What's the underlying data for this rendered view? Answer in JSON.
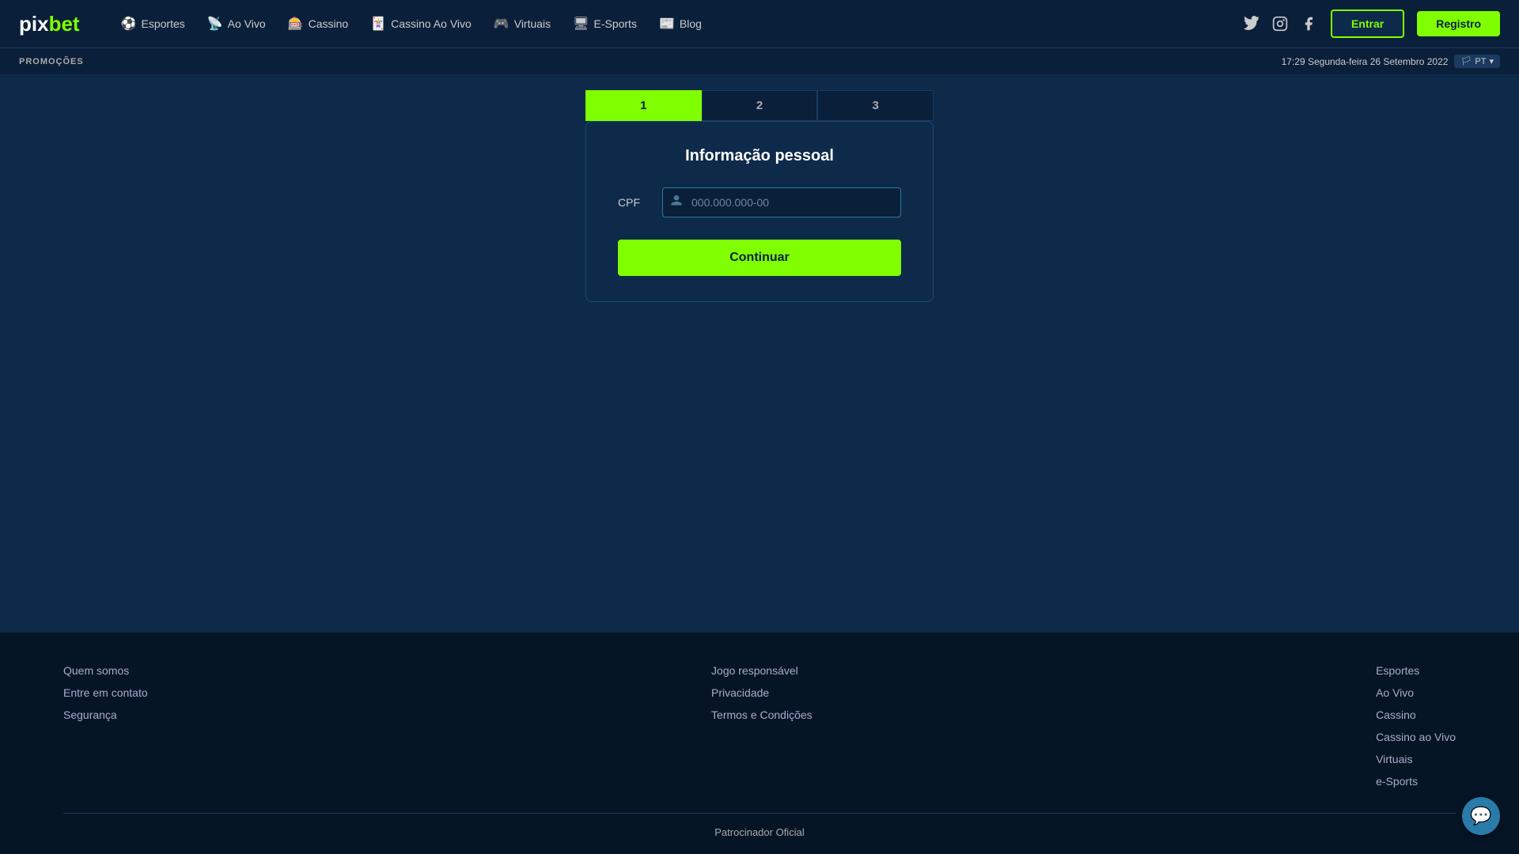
{
  "logo": {
    "pix": "pix",
    "bet": "bet"
  },
  "nav": {
    "items": [
      {
        "id": "esportes",
        "label": "Esportes",
        "icon": "⚽"
      },
      {
        "id": "ao-vivo",
        "label": "Ao Vivo",
        "icon": "📡"
      },
      {
        "id": "cassino",
        "label": "Cassino",
        "icon": "🎰"
      },
      {
        "id": "cassino-ao-vivo",
        "label": "Cassino Ao Vivo",
        "icon": "🃏"
      },
      {
        "id": "virtuais",
        "label": "Virtuais",
        "icon": "🎮"
      },
      {
        "id": "e-sports",
        "label": "E-Sports",
        "icon": "🖥"
      },
      {
        "id": "blog",
        "label": "Blog",
        "icon": "📰"
      }
    ],
    "entrar_label": "Entrar",
    "registro_label": "Registro"
  },
  "promo_bar": {
    "label": "PROMOÇÕES",
    "datetime": "17:29 Segunda-feira 26 Setembro 2022",
    "lang": "PT"
  },
  "steps": [
    {
      "number": "1",
      "active": true
    },
    {
      "number": "2",
      "active": false
    },
    {
      "number": "3",
      "active": false
    }
  ],
  "form": {
    "title": "Informação pessoal",
    "cpf_label": "CPF",
    "cpf_placeholder": "000.000.000-00",
    "continue_label": "Continuar"
  },
  "footer": {
    "col1": {
      "links": [
        "Quem somos",
        "Entre em contato",
        "Segurança"
      ]
    },
    "col2": {
      "links": [
        "Jogo responsável",
        "Privacidade",
        "Termos e Condições"
      ]
    },
    "col3": {
      "links": [
        "Esportes",
        "Ao Vivo",
        "Cassino",
        "Cassino ao Vivo",
        "Virtuais",
        "e-Sports"
      ]
    },
    "bottom_label": "Patrocinador Oficial"
  }
}
